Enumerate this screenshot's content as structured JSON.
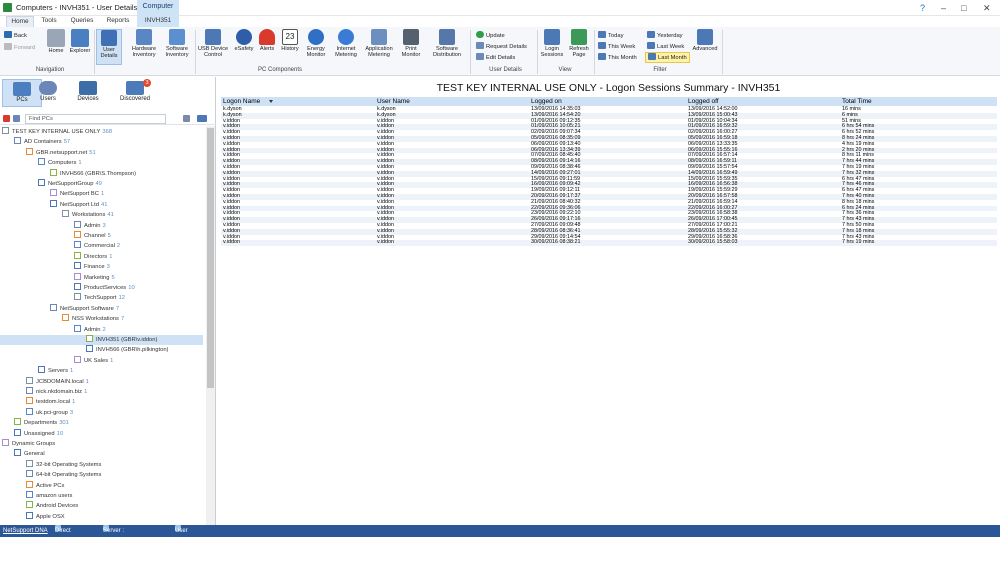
{
  "window": {
    "title": "Computers - INVH351 - User Details",
    "context_tab": "Computer",
    "context_sub": "INVH351"
  },
  "tabs": [
    "Home",
    "Tools",
    "Queries",
    "Reports"
  ],
  "ribbon": {
    "nav_back": "Back",
    "nav_forward": "Forward",
    "nav_group": "Navigation",
    "buttons": [
      "Home",
      "Explorer",
      "User\nDetails",
      "Hardware\nInventory",
      "Software\nInventory",
      "USB Device\nControl",
      "eSafety",
      "Alerts",
      "History",
      "Energy\nMonitor",
      "Internet\nMetering",
      "Application\nMetering",
      "Print\nMonitor",
      "Software\nDistribution"
    ],
    "pc_components_group": "PC Components",
    "user_details_items": [
      "Update",
      "Request Details",
      "Edit Details"
    ],
    "user_details_group": "User Details",
    "view_buttons": [
      "Login\nSessions",
      "Refresh\nPage"
    ],
    "view_group": "View",
    "filter_items": [
      "Today",
      "This Week",
      "This Month",
      "Yesterday",
      "Last Week",
      "Last Month"
    ],
    "advanced": "Advanced",
    "filter_group": "Filter"
  },
  "leftnav": {
    "tabs": [
      "PCs",
      "Users",
      "Devices",
      "Discovered"
    ],
    "discovered_badge": "3",
    "search_placeholder": "Find PCs",
    "tree": [
      {
        "label": "TEST KEY INTERNAL USE ONLY",
        "count": "368",
        "level": 0
      },
      {
        "label": "AD Containers",
        "count": "57",
        "level": 1
      },
      {
        "label": "GBR.netsupport.net",
        "count": "51",
        "level": 2
      },
      {
        "label": "Computers",
        "count": "1",
        "level": 3
      },
      {
        "label": "INVH566 (GBR\\S.Thompson)",
        "count": "",
        "level": 4
      },
      {
        "label": "NetSupportGroup",
        "count": "49",
        "level": 3
      },
      {
        "label": "NetSupport BC",
        "count": "1",
        "level": 4
      },
      {
        "label": "NetSupport Ltd",
        "count": "41",
        "level": 4
      },
      {
        "label": "Workstations",
        "count": "41",
        "level": 5
      },
      {
        "label": "Admin",
        "count": "3",
        "level": 6
      },
      {
        "label": "Channel",
        "count": "5",
        "level": 6
      },
      {
        "label": "Commercial",
        "count": "2",
        "level": 6
      },
      {
        "label": "Directors",
        "count": "1",
        "level": 6
      },
      {
        "label": "Finance",
        "count": "3",
        "level": 6
      },
      {
        "label": "Marketing",
        "count": "5",
        "level": 6
      },
      {
        "label": "ProductServices",
        "count": "10",
        "level": 6
      },
      {
        "label": "TechSupport",
        "count": "12",
        "level": 6
      },
      {
        "label": "NetSupport Software",
        "count": "7",
        "level": 4
      },
      {
        "label": "NSS Workstations",
        "count": "7",
        "level": 5
      },
      {
        "label": "Admin",
        "count": "2",
        "level": 6
      },
      {
        "label": "INVH351 (GBR\\v.iddon)",
        "count": "",
        "level": 7,
        "selected": true
      },
      {
        "label": "INVH566 (GBR\\h.pilkington)",
        "count": "",
        "level": 7
      },
      {
        "label": "UK Sales",
        "count": "1",
        "level": 6
      },
      {
        "label": "Servers",
        "count": "1",
        "level": 3
      },
      {
        "label": "JCBDOMAIN.local",
        "count": "1",
        "level": 2
      },
      {
        "label": "nick.nkdomain.biz",
        "count": "1",
        "level": 2
      },
      {
        "label": "testdom.local",
        "count": "1",
        "level": 2
      },
      {
        "label": "uk.pci-group",
        "count": "3",
        "level": 2
      },
      {
        "label": "Departments",
        "count": "301",
        "level": 1
      },
      {
        "label": "Unassigned",
        "count": "10",
        "level": 1
      },
      {
        "label": "Dynamic Groups",
        "count": "",
        "level": 0
      },
      {
        "label": "General",
        "count": "",
        "level": 1
      },
      {
        "label": "32-bit Operating Systems",
        "count": "",
        "level": 2
      },
      {
        "label": "64-bit Operating Systems",
        "count": "",
        "level": 2
      },
      {
        "label": "Active PCs",
        "count": "",
        "level": 2
      },
      {
        "label": "amazon users",
        "count": "",
        "level": 2
      },
      {
        "label": "Android Devices",
        "count": "",
        "level": 2
      },
      {
        "label": "Apple OSX",
        "count": "",
        "level": 2
      }
    ]
  },
  "report": {
    "title": "TEST KEY INTERNAL USE ONLY - Logon Sessions Summary - INVH351",
    "columns": [
      "Logon Name",
      "User Name",
      "Logged on",
      "Logged off",
      "Total Time"
    ],
    "rows": [
      [
        "k.dyson",
        "k.dyson",
        "13/09/2016 14:35:03",
        "13/09/2016 14:52:00",
        "16 mins"
      ],
      [
        "k.dyson",
        "k.dyson",
        "13/09/2016 14:54:20",
        "13/09/2016 15:00:43",
        "6 mins"
      ],
      [
        "v.iddon",
        "v.iddon",
        "01/09/2016 09:12:35",
        "01/09/2016 10:04:34",
        "51 mins"
      ],
      [
        "v.iddon",
        "v.iddon",
        "01/09/2016 10:05:21",
        "01/09/2016 16:59:32",
        "6 hrs 54 mins"
      ],
      [
        "v.iddon",
        "v.iddon",
        "02/09/2016 09:07:34",
        "02/09/2016 16:00:27",
        "6 hrs 52 mins"
      ],
      [
        "v.iddon",
        "v.iddon",
        "05/09/2016 08:35:09",
        "05/09/2016 16:59:18",
        "8 hrs 24 mins"
      ],
      [
        "v.iddon",
        "v.iddon",
        "06/09/2016 09:13:40",
        "06/09/2016 13:33:35",
        "4 hrs 19 mins"
      ],
      [
        "v.iddon",
        "v.iddon",
        "06/09/2016 13:34:39",
        "06/09/2016 15:55:16",
        "2 hrs 20 mins"
      ],
      [
        "v.iddon",
        "v.iddon",
        "07/09/2016 08:45:40",
        "07/09/2016 16:57:14",
        "8 hrs 11 mins"
      ],
      [
        "v.iddon",
        "v.iddon",
        "08/09/2016 09:14:16",
        "08/09/2016 16:59:11",
        "7 hrs 44 mins"
      ],
      [
        "v.iddon",
        "v.iddon",
        "09/09/2016 08:38:46",
        "09/09/2016 15:57:54",
        "7 hrs 19 mins"
      ],
      [
        "v.iddon",
        "v.iddon",
        "14/09/2016 09:27:01",
        "14/09/2016 16:59:49",
        "7 hrs 32 mins"
      ],
      [
        "v.iddon",
        "v.iddon",
        "15/09/2016 09:11:59",
        "15/09/2016 15:59:35",
        "6 hrs 47 mins"
      ],
      [
        "v.iddon",
        "v.iddon",
        "16/09/2016 09:09:42",
        "16/09/2016 16:56:38",
        "7 hrs 46 mins"
      ],
      [
        "v.iddon",
        "v.iddon",
        "19/09/2016 09:12:11",
        "19/09/2016 15:59:29",
        "6 hrs 47 mins"
      ],
      [
        "v.iddon",
        "v.iddon",
        "20/09/2016 09:17:37",
        "20/09/2016 16:57:58",
        "7 hrs 40 mins"
      ],
      [
        "v.iddon",
        "v.iddon",
        "21/09/2016 08:40:32",
        "21/09/2016 16:59:14",
        "8 hrs 18 mins"
      ],
      [
        "v.iddon",
        "v.iddon",
        "22/09/2016 09:36:06",
        "22/09/2016 16:00:27",
        "6 hrs 24 mins"
      ],
      [
        "v.iddon",
        "v.iddon",
        "23/09/2016 09:22:10",
        "23/09/2016 16:58:38",
        "7 hrs 36 mins"
      ],
      [
        "v.iddon",
        "v.iddon",
        "26/09/2016 09:17:16",
        "26/09/2016 17:00:45",
        "7 hrs 43 mins"
      ],
      [
        "v.iddon",
        "v.iddon",
        "27/09/2016 09:09:48",
        "27/09/2016 17:00:21",
        "7 hrs 50 mins"
      ],
      [
        "v.iddon",
        "v.iddon",
        "28/09/2016 08:36:41",
        "28/09/2016 15:55:32",
        "7 hrs 18 mins"
      ],
      [
        "v.iddon",
        "v.iddon",
        "29/09/2016 09:14:54",
        "29/09/2016 16:58:36",
        "7 hrs 43 mins"
      ],
      [
        "v.iddon",
        "v.iddon",
        "30/09/2016 08:38:21",
        "30/09/2016 15:58:03",
        "7 hrs 19 mins"
      ]
    ]
  },
  "status": {
    "dna": "NetSupport DNA",
    "mode": "Direct",
    "server": "Server : nslinet002",
    "user": "User : AJK"
  }
}
